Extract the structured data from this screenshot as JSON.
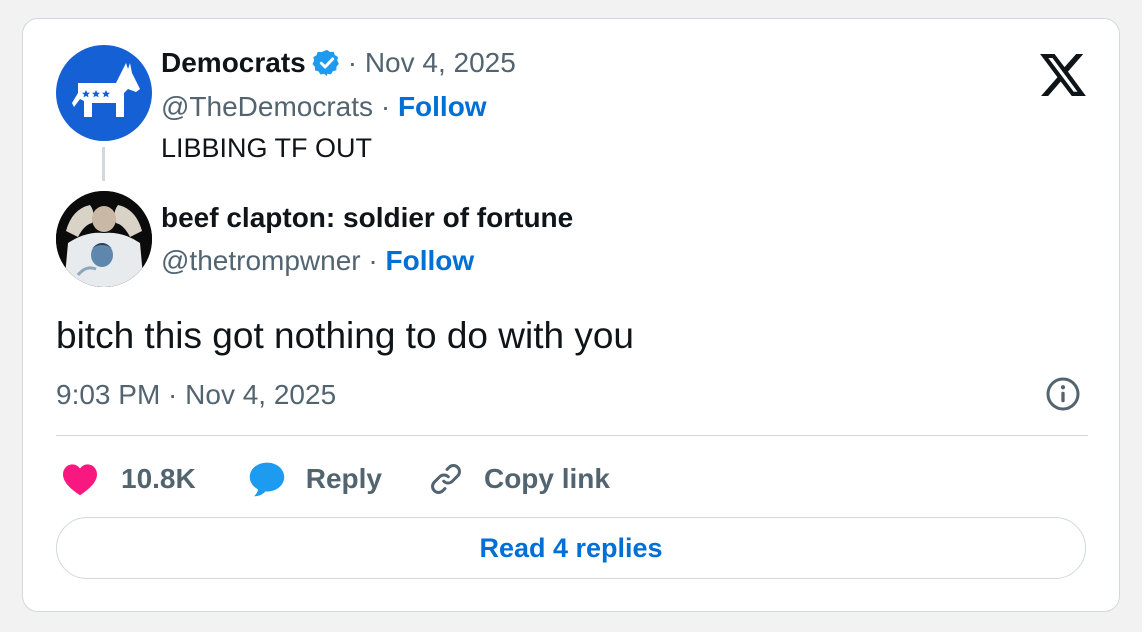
{
  "parent_tweet": {
    "author_name": "Democrats",
    "verified_icon": "verified-badge-icon",
    "date": "· Nov 4, 2025",
    "handle": "@TheDemocrats",
    "separator": " · ",
    "follow_label": "Follow",
    "text": "LIBBING TF OUT",
    "avatar_icon": "donkey-logo-icon"
  },
  "reply_tweet": {
    "author_name": "beef clapton: soldier of fortune",
    "handle": "@thetrompwner",
    "separator": " · ",
    "follow_label": "Follow",
    "text": "bitch this got nothing to do with you",
    "timestamp": "9:03 PM · Nov 4, 2025",
    "avatar_icon": "profile-photo"
  },
  "actions": {
    "like_count": "10.8K",
    "reply_label": "Reply",
    "copy_link_label": "Copy link"
  },
  "read_replies_label": "Read 4 replies",
  "icons": {
    "brand": "x-logo-icon",
    "info": "info-icon",
    "like": "heart-icon",
    "reply": "speech-bubble-icon",
    "copy": "link-icon"
  },
  "colors": {
    "accent": "#006fd6",
    "like": "#f91880",
    "reply": "#1d9bf0",
    "verified": "#1d9bf0",
    "muted": "#536471",
    "democrats_blue": "#1660d6"
  }
}
